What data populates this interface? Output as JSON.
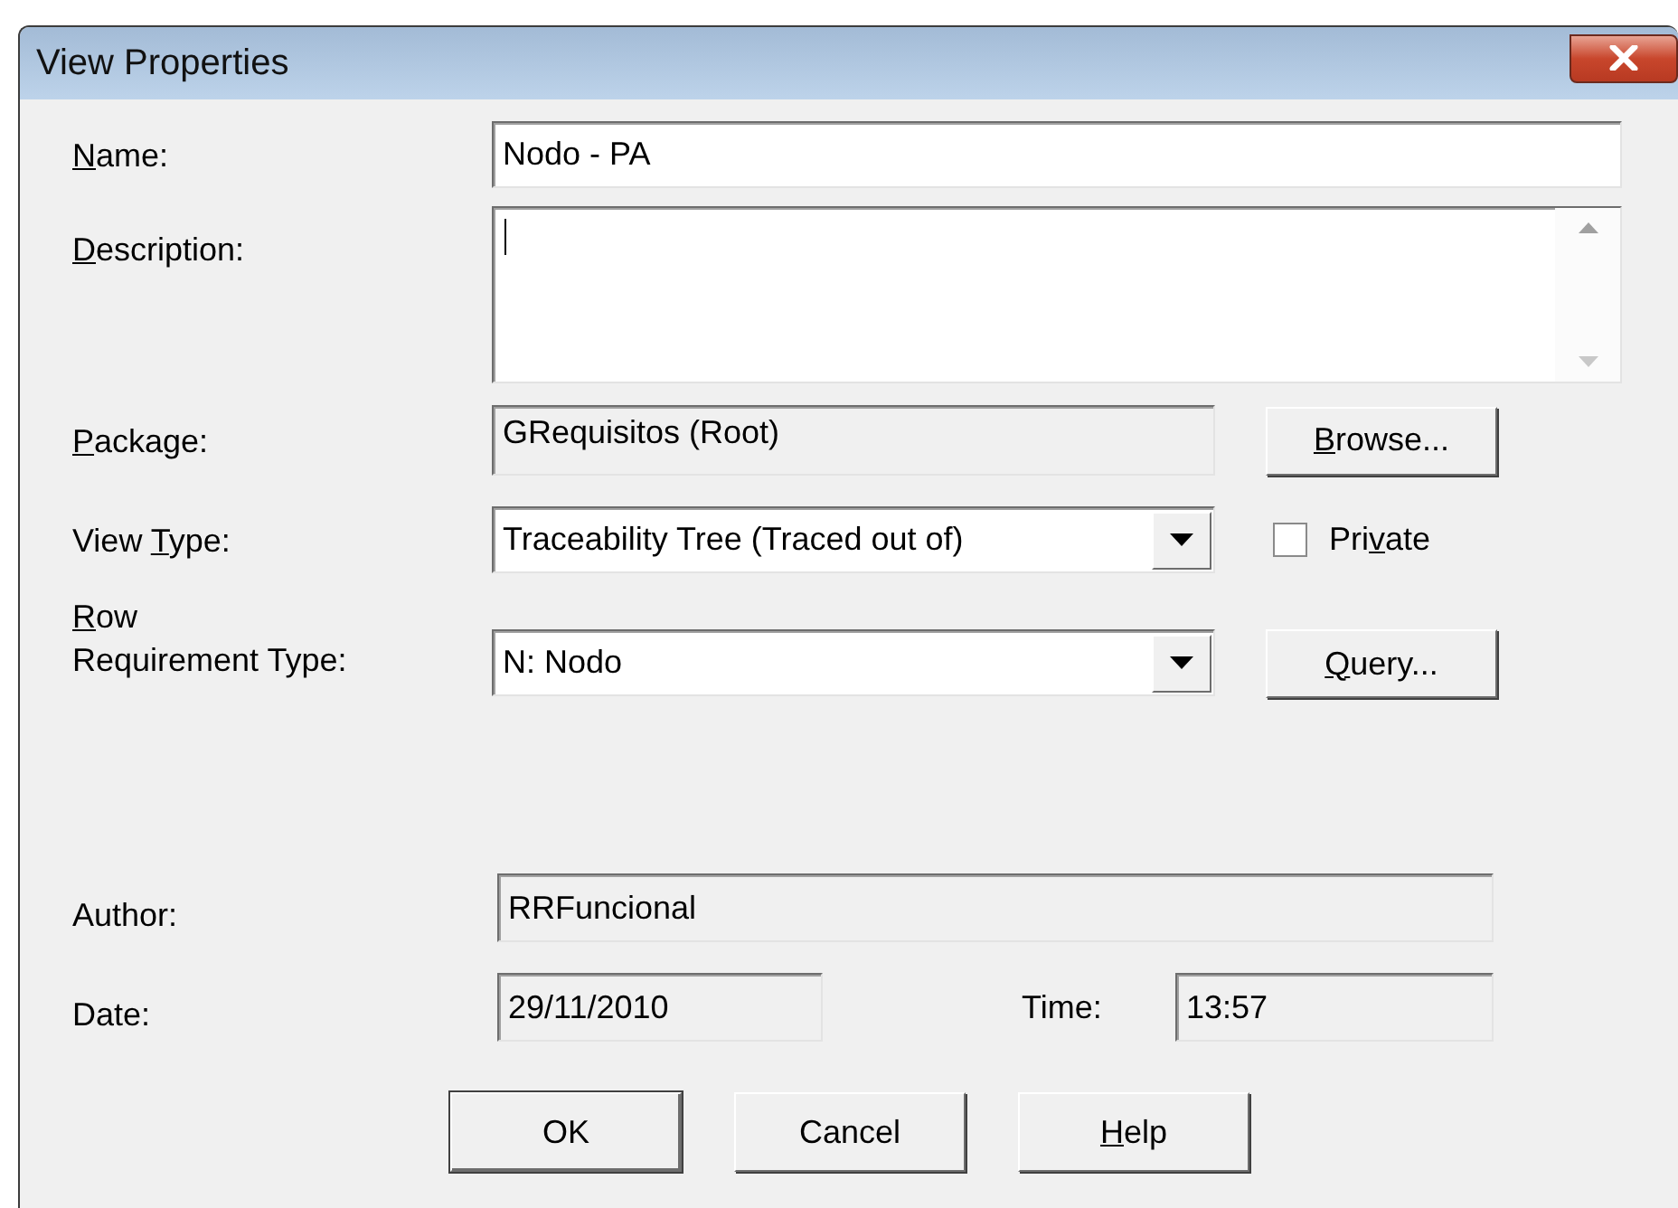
{
  "window": {
    "title": "View Properties"
  },
  "name": {
    "label": {
      "key": "N",
      "post": "ame:"
    },
    "value": "Nodo - PA",
    "read_only": false
  },
  "description": {
    "label": {
      "key": "D",
      "post": "escription:"
    },
    "read_only": false
  },
  "package": {
    "label": {
      "key": "P",
      "post": "ackage:"
    },
    "value": "GRequisitos (Root)",
    "read_only": true,
    "button": {
      "label": {
        "key": "B",
        "post": "rowse..."
      }
    }
  },
  "view_type": {
    "label": {
      "pre": "View ",
      "key": "T",
      "post": "ype:"
    },
    "value": "Traceability Tree (Traced out of)",
    "checkbox": {
      "label": {
        "pre": "Pri",
        "key": "v",
        "post": "ate"
      },
      "checked": false
    }
  },
  "row_requirement_type": {
    "label": {
      "key": "R",
      "post": "ow\nRequirement Type:"
    },
    "value": "N: Nodo",
    "button": {
      "label": {
        "key": "Q",
        "post": "uery..."
      }
    }
  },
  "author": {
    "label": {
      "pre": "Author:"
    },
    "value": "RRFuncional",
    "read_only": true
  },
  "date": {
    "label": {
      "pre": "Date:"
    },
    "value": "29/11/2010",
    "read_only": true
  },
  "time": {
    "label": {
      "pre": "Time:"
    },
    "value": "13:57",
    "read_only": true
  },
  "buttons": [
    {
      "label": {
        "pre": "OK"
      },
      "default": true
    },
    {
      "label": {
        "pre": "Cancel"
      },
      "default": false
    },
    {
      "label": {
        "key": "H",
        "post": "elp"
      },
      "default": false
    }
  ]
}
